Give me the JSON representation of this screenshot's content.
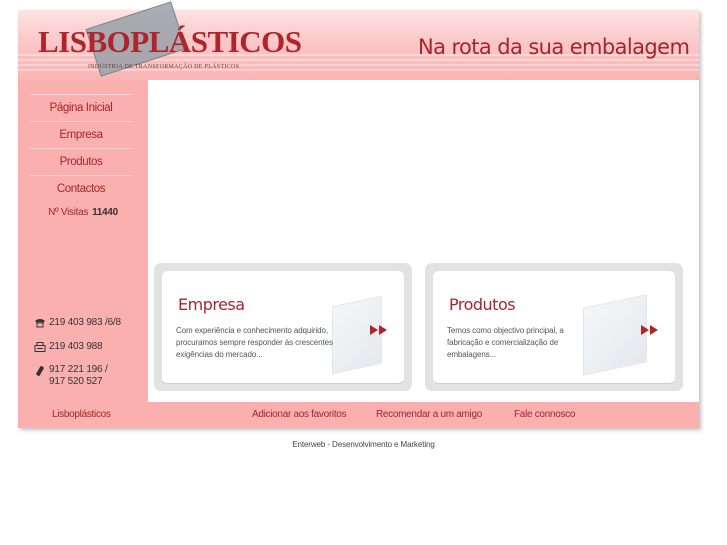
{
  "header": {
    "logo_text": "LISBOPLÁSTICOS",
    "logo_subtitle": "INDÚSTRIA DE TRANSFORMAÇÃO DE PLÁSTICOS",
    "tagline": "Na rota da sua embalagem"
  },
  "sidebar": {
    "nav": [
      {
        "label": "Página Inicial"
      },
      {
        "label": "Empresa"
      },
      {
        "label": "Produtos"
      },
      {
        "label": "Contactos"
      }
    ],
    "visits_label": "Nº Visitas",
    "visits_count": "11440",
    "contacts": {
      "phone": "219 403 983 /6/8",
      "fax": "219 403 988",
      "mobile_line1": "917 221 196 /",
      "mobile_line2": "917 520 527"
    }
  },
  "cards": [
    {
      "title": "Empresa",
      "text": "Com experiência e conhecimento adquirido, procuramos sempre responder às crescentes exigências do mercado..."
    },
    {
      "title": "Produtos",
      "text": "Temos como objectivo principal, a fabricação e comercialização de embalagens..."
    }
  ],
  "footer": {
    "brand": "Lisboplásticos",
    "add_favorites": "Adicionar aos favoritos",
    "recommend": "Recomendar a um amigo",
    "contact_us": "Fale connosco"
  },
  "credit": "Enterweb - Desenvolvimento e Marketing",
  "colors": {
    "brand_red": "#a3262c",
    "pink": "#fbb0b0"
  }
}
